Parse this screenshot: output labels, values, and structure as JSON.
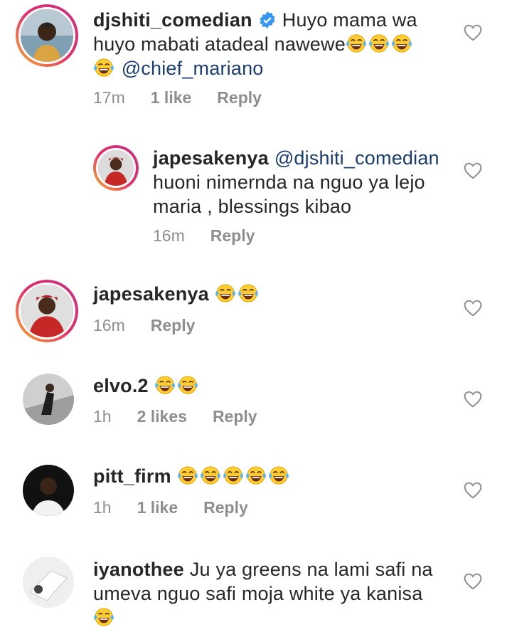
{
  "comments": [
    {
      "username": "djshiti_comedian",
      "verified": true,
      "line1": "Huyo mama wa",
      "line2": "huyo mabati atadeal nawewe",
      "mention": "@chief_mariano",
      "time": "17m",
      "likes": "1 like",
      "reply": "Reply"
    },
    {
      "username": "japesakenya",
      "mention": "@djshiti_comedian",
      "line1": "huoni nimernda na nguo ya lejo",
      "line2": "maria , blessings kibao",
      "time": "16m",
      "reply": "Reply"
    },
    {
      "username": "japesakenya",
      "time": "16m",
      "reply": "Reply"
    },
    {
      "username": "elvo.2",
      "time": "1h",
      "likes": "2 likes",
      "reply": "Reply"
    },
    {
      "username": "pitt_firm",
      "time": "1h",
      "likes": "1 like",
      "reply": "Reply"
    },
    {
      "username": "iyanothee",
      "line1": "Ju ya greens na lami safi na",
      "line2": "umeva nguo safi moja white ya kanisa"
    }
  ],
  "icons": {
    "emoji": "laughing-tears-emoji",
    "like": "heart-outline-icon",
    "verified": "verified-badge-icon"
  },
  "colors": {
    "mention": "#1a3d6e",
    "meta": "#8e8e8e",
    "verified": "#3897f0",
    "story_ring": "#e1306c"
  }
}
